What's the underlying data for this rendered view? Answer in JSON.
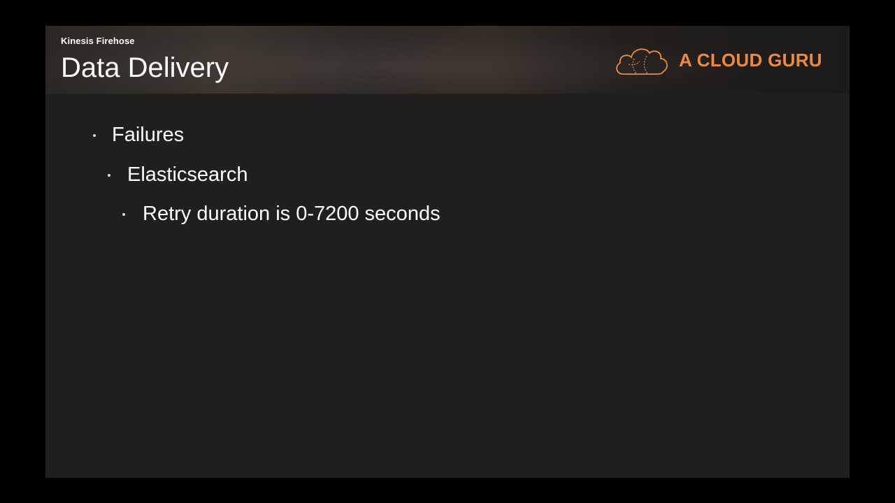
{
  "header": {
    "subtitle": "Kinesis Firehose",
    "title": "Data Delivery"
  },
  "logo": {
    "text": "A CLOUD GURU",
    "icon": "cloud-icon",
    "color": "#f08a3a"
  },
  "bullets": [
    {
      "level": 1,
      "text": "Failures"
    },
    {
      "level": 2,
      "text": "Elasticsearch"
    },
    {
      "level": 3,
      "text": "Retry duration is 0-7200 seconds"
    }
  ],
  "colors": {
    "background": "#000000",
    "slide": "#1f1f1f",
    "text": "#ffffff",
    "accent": "#f08a3a"
  }
}
